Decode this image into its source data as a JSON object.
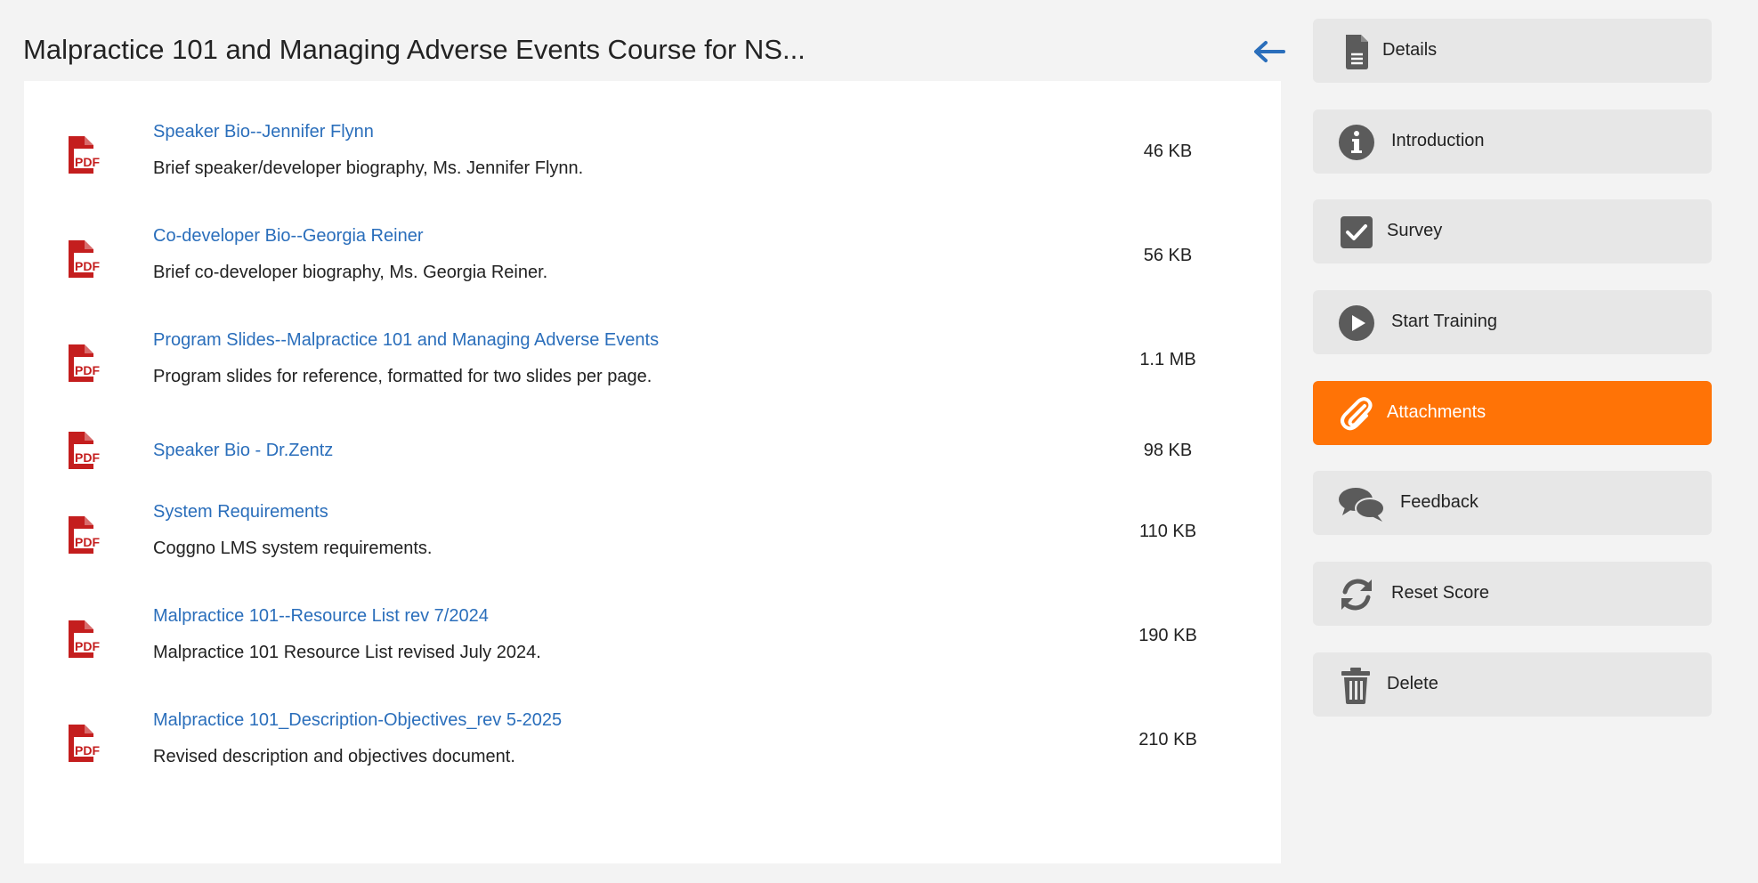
{
  "header": {
    "title": "Malpractice 101 and Managing Adverse Events Course for NS..."
  },
  "attachments": [
    {
      "name": "Speaker Bio--Jennifer Flynn",
      "description": "Brief speaker/developer biography, Ms. Jennifer Flynn.",
      "size": "46 KB",
      "icon": "pdf-icon",
      "icon_text": "PDF"
    },
    {
      "name": "Co-developer Bio--Georgia Reiner",
      "description": "Brief co-developer biography, Ms. Georgia Reiner.",
      "size": "56 KB",
      "icon": "pdf-icon",
      "icon_text": "PDF"
    },
    {
      "name": "Program Slides--Malpractice 101 and Managing Adverse Events",
      "description": "Program slides for reference, formatted for two slides per page.",
      "size": "1.1 MB",
      "icon": "pdf-icon",
      "icon_text": "PDF"
    },
    {
      "name": "Speaker Bio - Dr.Zentz",
      "description": "",
      "size": "98 KB",
      "icon": "pdf-icon",
      "icon_text": "PDF"
    },
    {
      "name": "System Requirements",
      "description": "Coggno LMS system requirements.",
      "size": "110 KB",
      "icon": "pdf-icon",
      "icon_text": "PDF"
    },
    {
      "name": "Malpractice 101--Resource List rev 7/2024",
      "description": "Malpractice 101 Resource List revised July 2024.",
      "size": "190 KB",
      "icon": "pdf-icon",
      "icon_text": "PDF"
    },
    {
      "name": "Malpractice 101_Description-Objectives_rev 5-2025",
      "description": "Revised description and objectives document.",
      "size": "210 KB",
      "icon": "pdf-icon",
      "icon_text": "PDF"
    }
  ],
  "sidebar": {
    "items": [
      {
        "label": "Details",
        "icon": "document-icon"
      },
      {
        "label": "Introduction",
        "icon": "info-icon"
      },
      {
        "label": "Survey",
        "icon": "checkbox-icon"
      },
      {
        "label": "Start Training",
        "icon": "play-icon"
      },
      {
        "label": "Attachments",
        "icon": "paperclip-icon"
      },
      {
        "label": "Feedback",
        "icon": "chat-bubbles-icon"
      },
      {
        "label": "Reset Score",
        "icon": "refresh-icon"
      },
      {
        "label": "Delete",
        "icon": "trash-icon"
      }
    ],
    "active": "Attachments"
  },
  "colors": {
    "background": "#f3f3f3",
    "link": "#2a6ebb",
    "pdf_red": "#c41e1e",
    "accent_active": "#ff7306",
    "button_bg": "#e7e7e7",
    "icon_gray": "#5b5b5b",
    "back_arrow": "#2a6ebb"
  }
}
